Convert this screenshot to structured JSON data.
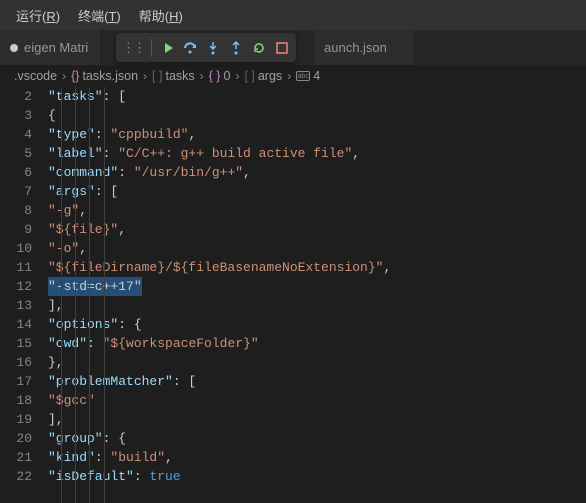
{
  "menubar": {
    "run": "运行",
    "run_key": "R",
    "terminal": "终端",
    "terminal_key": "T",
    "help": "帮助",
    "help_key": "H"
  },
  "tabs": {
    "left_label": "eigen Matri",
    "right_label": "aunch.json"
  },
  "breadcrumbs": {
    "folder": ".vscode",
    "file": "tasks.json",
    "p1": "tasks",
    "p2": "0",
    "p3": "args",
    "p4": "4"
  },
  "code": {
    "tasks_key": "\"tasks\"",
    "type_key": "\"type\"",
    "type_val": "\"cppbuild\"",
    "label_key": "\"label\"",
    "label_val": "\"C/C++: g++ build active file\"",
    "command_key": "\"command\"",
    "command_val": "\"/usr/bin/g++\"",
    "args_key": "\"args\"",
    "args0": "\"-g\"",
    "args1": "\"${file}\"",
    "args2": "\"-o\"",
    "args3": "\"${fileDirname}/${fileBasenameNoExtension}\"",
    "args4": "\"-std=c++17\"",
    "options_key": "\"options\"",
    "cwd_key": "\"cwd\"",
    "cwd_val": "\"${workspaceFolder}\"",
    "problemMatcher_key": "\"problemMatcher\"",
    "pm0": "\"$gcc\"",
    "group_key": "\"group\"",
    "kind_key": "\"kind\"",
    "kind_val": "\"build\"",
    "isDefault_key": "\"isDefault\"",
    "isDefault_val": "true"
  },
  "lines": [
    "2",
    "3",
    "4",
    "5",
    "6",
    "7",
    "8",
    "9",
    "10",
    "11",
    "12",
    "13",
    "14",
    "15",
    "16",
    "17",
    "18",
    "19",
    "20",
    "21",
    "22"
  ]
}
